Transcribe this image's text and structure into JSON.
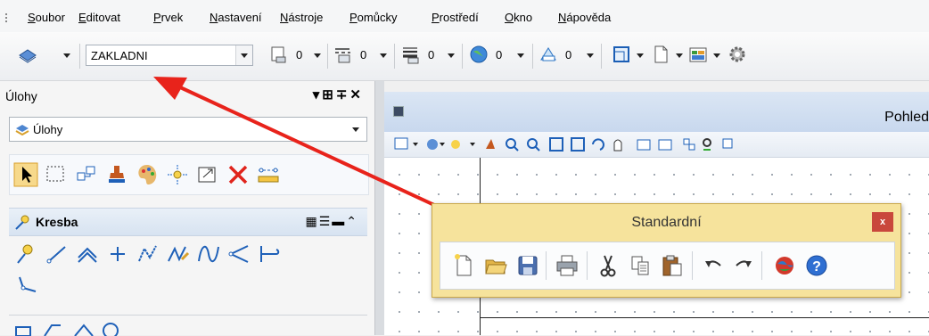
{
  "menu": {
    "items": [
      {
        "label": "Soubor"
      },
      {
        "label": "Editovat"
      },
      {
        "label": "Prvek"
      },
      {
        "label": "Nastavení"
      },
      {
        "label": "Nástroje"
      },
      {
        "label": "Pomůcky"
      },
      {
        "label": "Prostředí"
      },
      {
        "label": "Okno"
      },
      {
        "label": "Nápověda"
      }
    ]
  },
  "toolbar": {
    "level": "ZAKLADNI",
    "color_value": "0",
    "style_value": "0",
    "weight_value": "0",
    "transparency_value": "0",
    "priority_value": "0"
  },
  "left_panel": {
    "title": "Úlohy",
    "tasks_selected": "Úlohy",
    "section_label": "Kresba"
  },
  "view": {
    "title": "Pohled"
  },
  "dialog": {
    "title": "Standardní",
    "close_label": "x"
  },
  "colors": {
    "arrow": "#e8231b",
    "dialog_bg": "#f6e39c",
    "close_bg": "#c9473c",
    "view_header": "#c8d8ee"
  }
}
